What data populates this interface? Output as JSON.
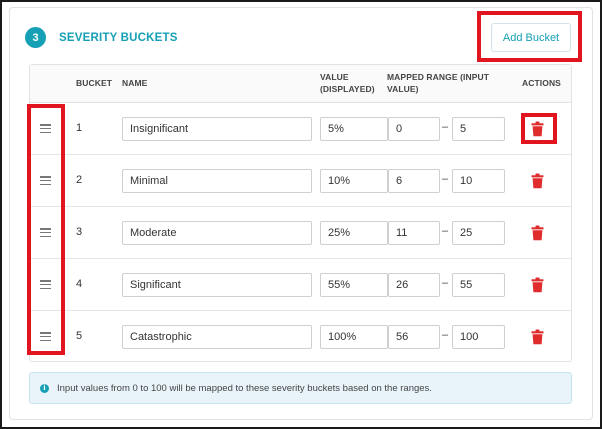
{
  "section": {
    "step_number": "3",
    "title": "SEVERITY BUCKETS",
    "add_button_label": "Add Bucket"
  },
  "table": {
    "headers": {
      "bucket": "BUCKET",
      "name": "NAME",
      "value_line1": "VALUE",
      "value_line2": "(DISPLAYED)",
      "range_line1": "MAPPED RANGE (INPUT",
      "range_line2": "VALUE)",
      "actions": "ACTIONS"
    },
    "rows": [
      {
        "bucket": "1",
        "name": "Insignificant",
        "value": "5%",
        "range_min": "0",
        "range_max": "5"
      },
      {
        "bucket": "2",
        "name": "Minimal",
        "value": "10%",
        "range_min": "6",
        "range_max": "10"
      },
      {
        "bucket": "3",
        "name": "Moderate",
        "value": "25%",
        "range_min": "11",
        "range_max": "25"
      },
      {
        "bucket": "4",
        "name": "Significant",
        "value": "55%",
        "range_min": "26",
        "range_max": "55"
      },
      {
        "bucket": "5",
        "name": "Catastrophic",
        "value": "100%",
        "range_min": "56",
        "range_max": "100"
      }
    ],
    "range_separator": "–"
  },
  "info": {
    "icon": "i",
    "text": "Input values from 0 to 100 will be mapped to these severity buckets based on the ranges."
  },
  "colors": {
    "accent": "#16a0b5",
    "delete": "#e02c2c",
    "highlight_box": "#e0151f"
  }
}
